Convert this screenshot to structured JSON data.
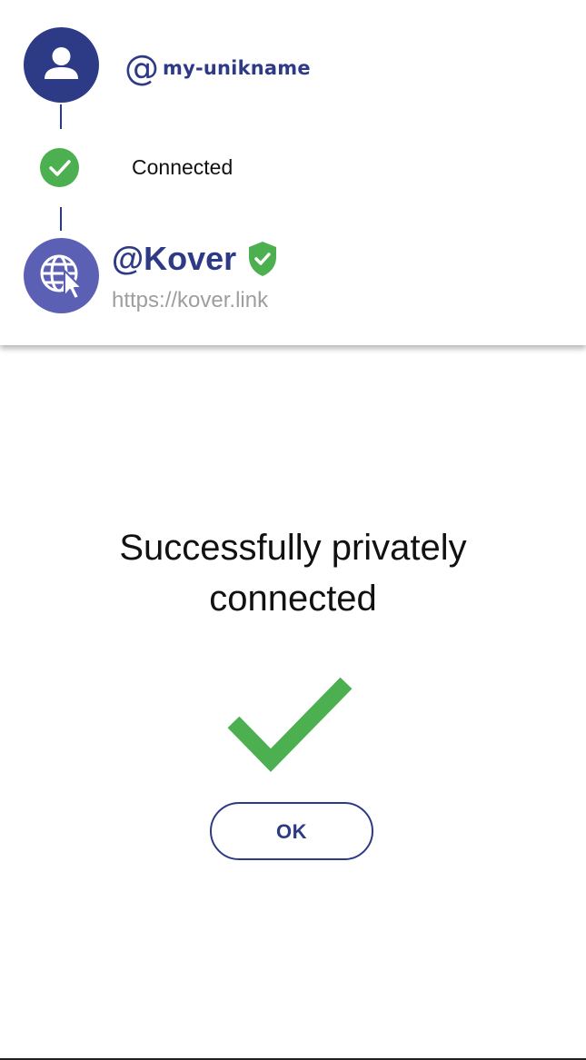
{
  "header": {
    "user": {
      "avatar_icon": "person-icon",
      "at_sign": "@",
      "username": "my-unikname"
    },
    "status": {
      "icon": "check-circle-icon",
      "text": "Connected"
    },
    "site": {
      "avatar_icon": "globe-cursor-icon",
      "name": "@Kover",
      "verified_icon": "shield-check-icon",
      "url": "https://kover.link"
    }
  },
  "main": {
    "message_line1": "Successfully privately",
    "message_line2": "connected",
    "success_icon": "checkmark-icon",
    "ok_label": "OK"
  },
  "colors": {
    "brand_navy": "#2d3a86",
    "site_purple": "#5c60b5",
    "success_green": "#4caf50",
    "url_gray": "#9e9e9e"
  }
}
